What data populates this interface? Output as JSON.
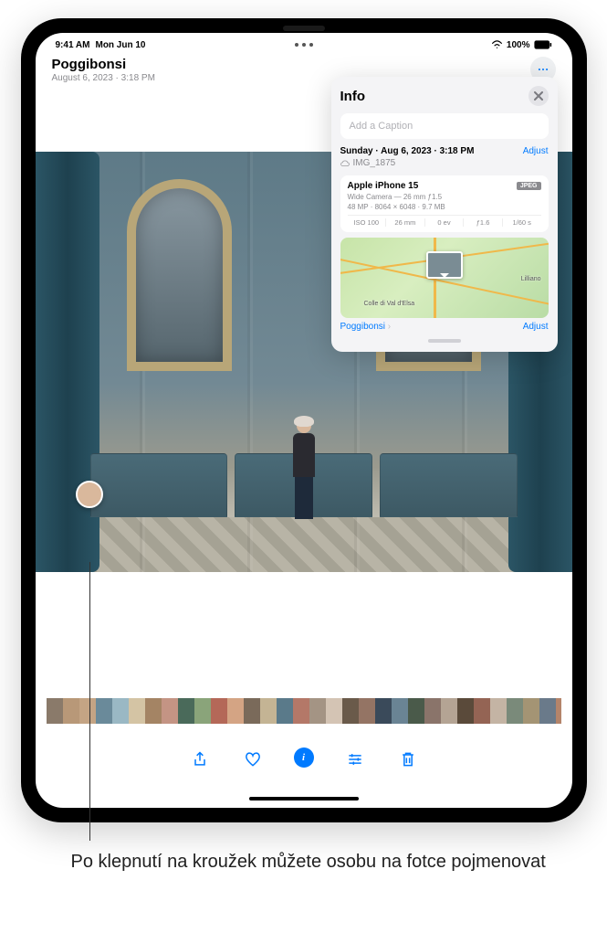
{
  "status": {
    "time": "9:41 AM",
    "date": "Mon Jun 10",
    "battery": "100%"
  },
  "header": {
    "title": "Poggibonsi",
    "subtitle": "August 6, 2023 · 3:18 PM"
  },
  "info_panel": {
    "title": "Info",
    "caption_placeholder": "Add a Caption",
    "date_line": "Sunday · Aug 6, 2023 · 3:18 PM",
    "adjust_label": "Adjust",
    "filename": "IMG_1875",
    "camera": {
      "device": "Apple iPhone 15",
      "badge": "JPEG",
      "lens": "Wide Camera — 26 mm ƒ1.5",
      "resolution": "48 MP · 8064 × 6048 · 9.7 MB",
      "specs": {
        "iso": "ISO 100",
        "focal": "26 mm",
        "ev": "0 ev",
        "aperture": "ƒ1.6",
        "shutter": "1/60 s"
      }
    },
    "map": {
      "location_link": "Poggibonsi",
      "labels": [
        "Colle di Val d'Elsa",
        "Lilliano"
      ],
      "adjust_label": "Adjust"
    }
  },
  "toolbar": {
    "share": "Share",
    "favorite": "Favorite",
    "info": "Info",
    "edit": "Edit",
    "delete": "Delete"
  },
  "callout": "Po klepnutí na kroužek můžete osobu na fotce pojmenovat"
}
